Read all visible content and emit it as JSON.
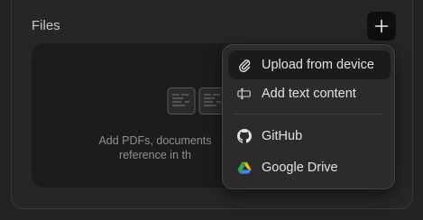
{
  "files": {
    "title": "Files",
    "dropzone_text_line1": "Add PDFs, documents",
    "dropzone_text_line2": "reference in th"
  },
  "menu": {
    "items": [
      {
        "label": "Upload from device",
        "icon": "paperclip-icon"
      },
      {
        "label": "Add text content",
        "icon": "text-content-icon"
      },
      {
        "label": "GitHub",
        "icon": "github-icon"
      },
      {
        "label": "Google Drive",
        "icon": "google-drive-icon"
      }
    ]
  }
}
